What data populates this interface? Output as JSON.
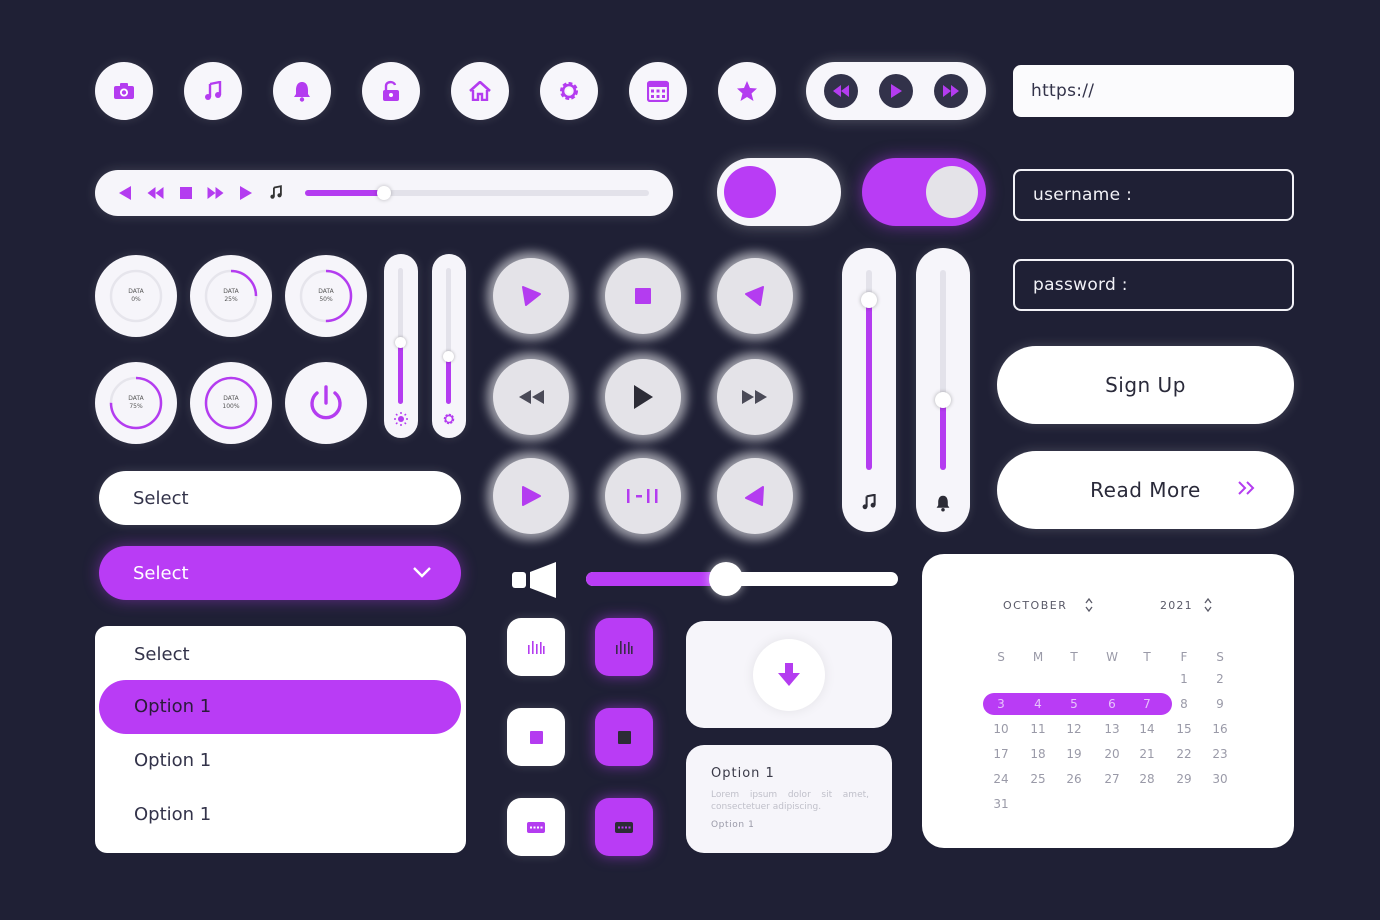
{
  "colors": {
    "accent": "#b43cf0",
    "background": "#1f2035",
    "surface": "#ffffff"
  },
  "top_icons": [
    "camera-icon",
    "music-icon",
    "bell-icon",
    "unlock-icon",
    "home-icon",
    "gear-icon",
    "calendar-icon",
    "star-icon"
  ],
  "media_controls": [
    "rewind-icon",
    "play-icon",
    "fast-forward-icon"
  ],
  "url_field": {
    "value": "https://"
  },
  "player": {
    "progress": 0.23
  },
  "toggles": [
    {
      "state": "off"
    },
    {
      "state": "on"
    }
  ],
  "login": {
    "username_placeholder": "username :",
    "password_placeholder": "password :"
  },
  "buttons": {
    "sign_up": "Sign Up",
    "read_more": "Read More",
    "read_more_icon": "double-chevron-right-icon"
  },
  "dials": [
    {
      "label": "DATA",
      "value": "0%",
      "percent": 0
    },
    {
      "label": "DATA",
      "value": "25%",
      "percent": 25
    },
    {
      "label": "DATA",
      "value": "50%",
      "percent": 50
    },
    {
      "label": "DATA",
      "value": "75%",
      "percent": 75
    },
    {
      "label": "DATA",
      "value": "100%",
      "percent": 100
    }
  ],
  "power_icon": "power-icon",
  "small_vsliders": [
    {
      "level": 0.45,
      "icon": "brightness-icon"
    },
    {
      "level": 0.35,
      "icon": "gear-icon"
    }
  ],
  "blur_buttons": [
    "play-icon",
    "stop-icon",
    "play-left-icon",
    "rewind-icon",
    "play-icon",
    "fast-forward-icon",
    "play-icon",
    "pause-step-icon",
    "play-left-icon"
  ],
  "big_vsliders": [
    {
      "level": 0.85,
      "icon": "music-icon"
    },
    {
      "level": 0.35,
      "icon": "bell-icon"
    }
  ],
  "selects": {
    "plain": "Select",
    "active": "Select"
  },
  "dropdown": {
    "header": "Select",
    "options": [
      "Option 1",
      "Option 1",
      "Option 1"
    ],
    "selected_index": 0
  },
  "volume": {
    "level": 0.45,
    "icon": "speaker-icon"
  },
  "square_buttons": [
    "equalizer-icon",
    "stop-icon",
    "keyboard-icon"
  ],
  "download_icon": "download-icon",
  "card": {
    "title": "Option 1",
    "body": "Lorem ipsum dolor sit amet, consectetuer adipiscing.",
    "footer": "Option 1"
  },
  "calendar": {
    "month": "OCTOBER",
    "year": "2021",
    "weekdays": [
      "S",
      "M",
      "T",
      "W",
      "T",
      "F",
      "S"
    ],
    "weeks": [
      [
        "",
        "",
        "",
        "",
        "",
        "1",
        "2"
      ],
      [
        "3",
        "4",
        "5",
        "6",
        "7",
        "8",
        "9"
      ],
      [
        "10",
        "11",
        "12",
        "13",
        "14",
        "15",
        "16"
      ],
      [
        "17",
        "18",
        "19",
        "20",
        "21",
        "22",
        "23"
      ],
      [
        "24",
        "25",
        "26",
        "27",
        "28",
        "29",
        "30"
      ],
      [
        "31",
        "",
        "",
        "",
        "",
        "",
        ""
      ]
    ],
    "selected_range": [
      "3",
      "7"
    ]
  }
}
